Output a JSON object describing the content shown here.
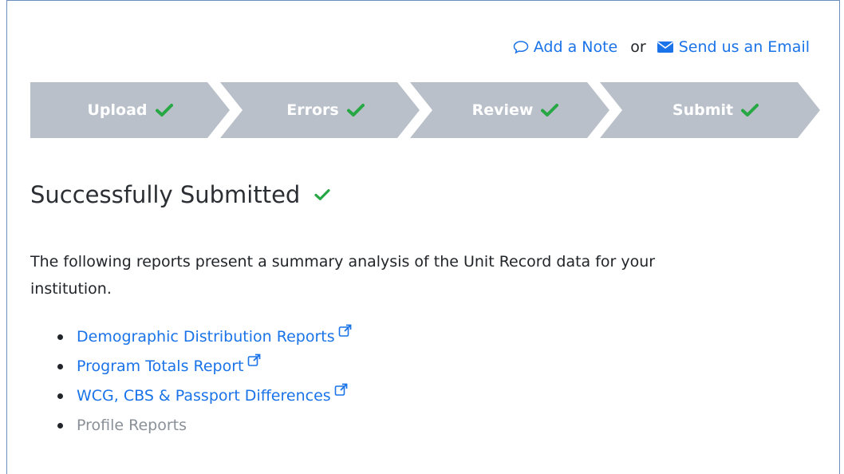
{
  "top_links": {
    "add_note": "Add a Note",
    "or": "or",
    "send_email": "Send us an Email"
  },
  "steps": [
    {
      "label": "Upload",
      "status": "complete"
    },
    {
      "label": "Errors",
      "status": "complete"
    },
    {
      "label": "Review",
      "status": "complete"
    },
    {
      "label": "Submit",
      "status": "complete"
    }
  ],
  "heading": "Successfully Submitted",
  "description": "The following reports present a summary analysis of the Unit Record data for your institution.",
  "reports": [
    {
      "label": "Demographic Distribution Reports",
      "external": true
    },
    {
      "label": "Program Totals Report",
      "external": true
    },
    {
      "label": "WCG, CBS & Passport Differences",
      "external": true
    },
    {
      "label": "Profile Reports",
      "disabled": true
    }
  ],
  "colors": {
    "link": "#1a73e8",
    "step_bg": "#b9c0c9",
    "check": "#28a745",
    "disabled_text": "#8a9097"
  },
  "icons": {
    "note": "speech-bubble-icon",
    "email": "envelope-icon",
    "check": "checkmark-icon",
    "external": "external-link-icon"
  }
}
